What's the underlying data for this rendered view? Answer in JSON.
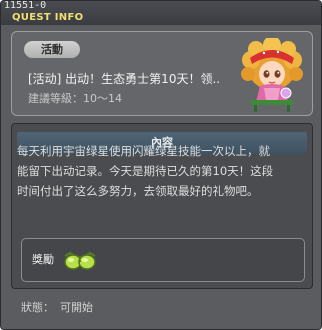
{
  "window": {
    "quest_id": "11551-0",
    "title": "QUEST INFO"
  },
  "quest": {
    "category_label": "活動",
    "name": "[活动] 出动！生态勇士第10天！领..",
    "level_requirement": "建議等級：10～14",
    "npc_icon": "npc-girl-portrait-icon"
  },
  "content": {
    "header": "內容",
    "text_line_1": "每天利用宇宙绿星使用闪耀绿星技能一次以上，就",
    "text_line_2": "能留下出动记录。今天是期待已久的第10天！这段",
    "text_line_3": "时间付出了这么多努力，去领取最好的礼物吧。"
  },
  "reward": {
    "label": "獎勵",
    "item_icon": "green-glasses-icon"
  },
  "status": {
    "label": "狀態：",
    "value": "可開始"
  },
  "colors": {
    "title": "#f0e070",
    "content_header": "#4f6474",
    "window_bg": "#5a5c60"
  }
}
